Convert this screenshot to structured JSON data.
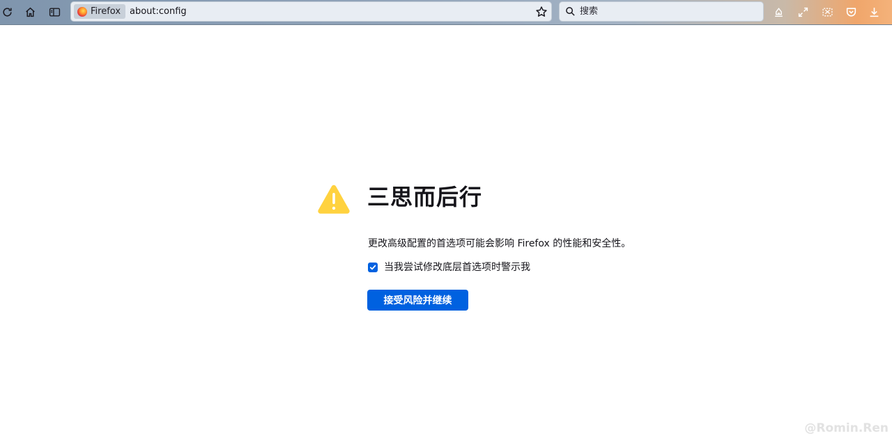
{
  "toolbar": {
    "icons": [
      "reload-icon",
      "home-icon",
      "sidebar-icon",
      "star-icon",
      "search-icon",
      "extension-icon",
      "fullscreen-icon",
      "screenshot-icon",
      "pocket-icon",
      "download-icon"
    ]
  },
  "urlbar": {
    "identity_label": "Firefox",
    "url": "about:config"
  },
  "search": {
    "placeholder": "搜索"
  },
  "page": {
    "title": "三思而后行",
    "description": "更改高级配置的首选项可能会影响 Firefox 的性能和安全性。",
    "checkbox_label": "当我尝试修改底层首选项时警示我",
    "checkbox_checked": true,
    "accept_button": "接受风险并继续"
  },
  "watermark": "@Romin.Ren",
  "colors": {
    "accent": "#0061e0",
    "warning": "#ffd23f"
  }
}
